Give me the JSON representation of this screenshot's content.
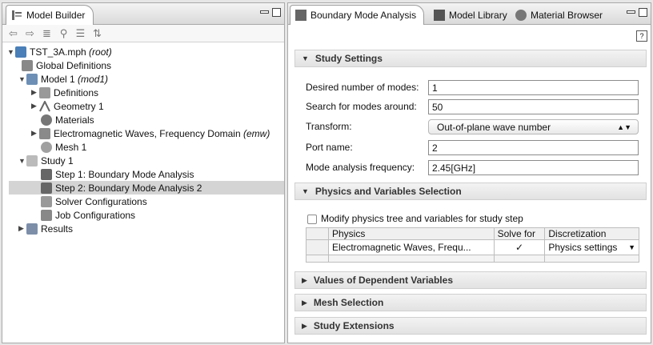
{
  "left_panel": {
    "tab_title": "Model Builder",
    "toolbar_icons": [
      "back-arrow-icon",
      "forward-arrow-icon",
      "collapse-icon",
      "show-icon",
      "expand-icon",
      "sort-icon"
    ],
    "tree": [
      {
        "label": "TST_3A.mph",
        "suffix": "(root)",
        "icon": "mph-file-icon",
        "expanded": true
      },
      {
        "label": "Global Definitions",
        "suffix": "",
        "icon": "global-definitions-icon"
      },
      {
        "label": "Model 1",
        "suffix": "(mod1)",
        "icon": "model-icon",
        "expanded": true
      },
      {
        "label": "Definitions",
        "suffix": "",
        "icon": "definitions-icon",
        "expanded": false
      },
      {
        "label": "Geometry 1",
        "suffix": "",
        "icon": "geometry-icon",
        "expanded": false
      },
      {
        "label": "Materials",
        "suffix": "",
        "icon": "materials-icon"
      },
      {
        "label": "Electromagnetic Waves, Frequency Domain",
        "suffix": "(emw)",
        "icon": "physics-icon",
        "expanded": false
      },
      {
        "label": "Mesh 1",
        "suffix": "",
        "icon": "mesh-icon"
      },
      {
        "label": "Study 1",
        "suffix": "",
        "icon": "study-icon",
        "expanded": true
      },
      {
        "label": "Step 1: Boundary Mode Analysis",
        "suffix": "",
        "icon": "study-step-icon"
      },
      {
        "label": "Step 2: Boundary Mode Analysis 2",
        "suffix": "",
        "icon": "study-step-icon",
        "selected": true
      },
      {
        "label": "Solver Configurations",
        "suffix": "",
        "icon": "solver-icon"
      },
      {
        "label": "Job Configurations",
        "suffix": "",
        "icon": "job-icon"
      },
      {
        "label": "Results",
        "suffix": "",
        "icon": "results-icon",
        "expanded": false
      }
    ]
  },
  "right_panel": {
    "tabs": [
      {
        "label": "Boundary Mode Analysis",
        "icon": "study-step-icon",
        "active": true
      },
      {
        "label": "Model Library",
        "icon": "library-icon",
        "active": false
      },
      {
        "label": "Material Browser",
        "icon": "material-browser-icon",
        "active": false
      }
    ],
    "study_settings": {
      "header": "Study Settings",
      "fields": [
        {
          "label": "Desired number of modes:",
          "value": "1"
        },
        {
          "label": "Search for modes around:",
          "value": "50"
        },
        {
          "label": "Transform:",
          "value": "Out-of-plane wave number",
          "type": "select"
        },
        {
          "label": "Port name:",
          "value": "2"
        },
        {
          "label": "Mode analysis frequency:",
          "value": "2.45[GHz]"
        }
      ]
    },
    "physics_selection": {
      "header": "Physics and Variables Selection",
      "checkbox_label": "Modify physics tree and variables for study step",
      "checked": false,
      "columns": [
        "Physics",
        "Solve for",
        "Discretization"
      ],
      "rows": [
        {
          "physics": "Electromagnetic Waves, Frequ...",
          "solve_for": "✓",
          "discretization": "Physics settings"
        }
      ]
    },
    "collapsed_sections": [
      "Values of Dependent Variables",
      "Mesh Selection",
      "Study Extensions"
    ]
  }
}
